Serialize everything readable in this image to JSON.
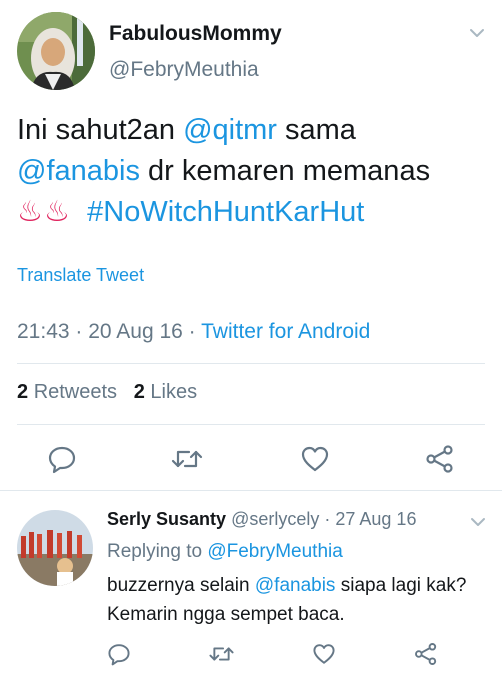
{
  "tweet": {
    "author_name": "FabulousMommy",
    "author_handle": "@FebryMeuthia",
    "text_part1": "Ini sahut2an ",
    "mention1": "@qitmr",
    "text_part2": " sama ",
    "mention2": "@fanabis",
    "text_part3": " dr kemaren memanas ",
    "emoji": "♨♨",
    "hashtag": "#NoWitchHuntKarHut",
    "translate_label": "Translate Tweet",
    "time": "21:43",
    "date": "20 Aug 16",
    "source": "Twitter for Android",
    "retweets_count": "2",
    "retweets_label": "Retweets",
    "likes_count": "2",
    "likes_label": "Likes"
  },
  "reply": {
    "author_name": "Serly Susanty",
    "author_handle": "@serlycely",
    "date": "27 Aug 16",
    "replying_prefix": "Replying to",
    "replying_to": "@FebryMeuthia",
    "text_part1": "buzzernya selain ",
    "mention": "@fanabis",
    "text_part2": " siapa lagi kak? Kemarin ngga sempet baca."
  },
  "icons": {
    "reply": "reply-icon",
    "retweet": "retweet-icon",
    "like": "heart-icon",
    "share": "share-icon",
    "more": "chevron-down-icon"
  },
  "colors": {
    "link": "#1b95e0",
    "secondary_text": "#657786",
    "primary_text": "#14171a",
    "divider": "#e1e8ed",
    "emoji": "#e0245e"
  }
}
